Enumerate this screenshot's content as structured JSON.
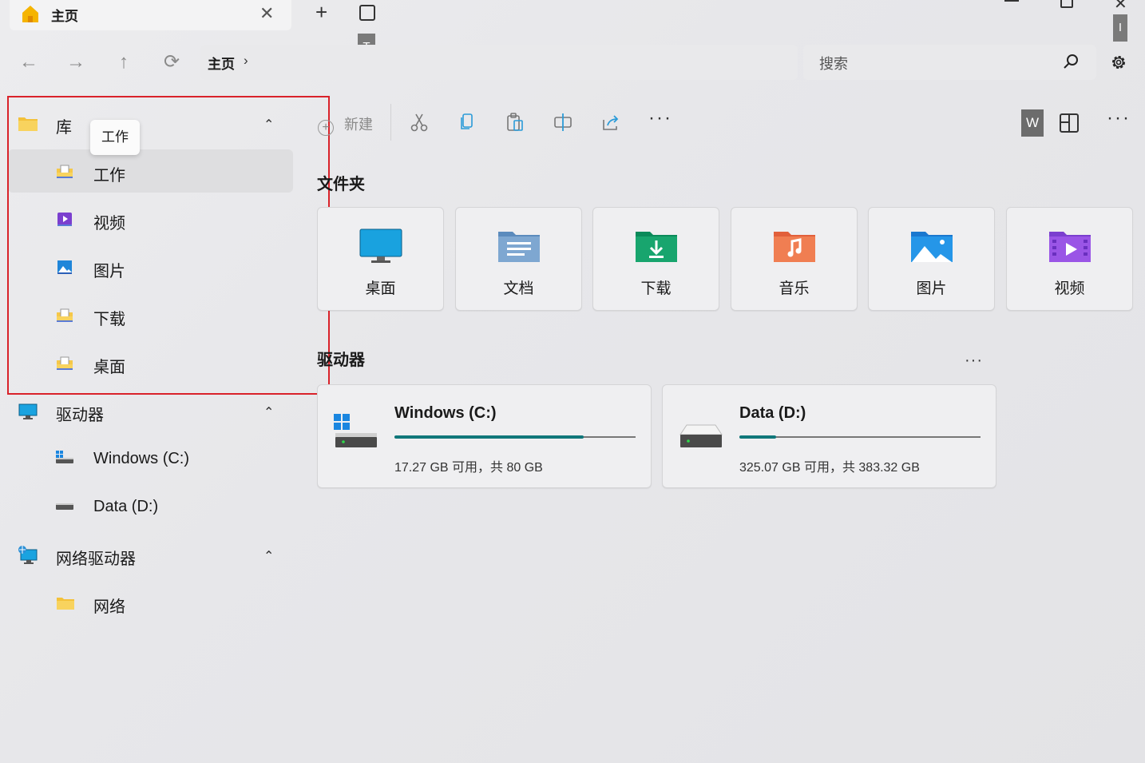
{
  "tab": {
    "title": "主页",
    "close": "✕",
    "new_tab": "+"
  },
  "tooltips": {
    "t": "T",
    "i": "I",
    "work": "工作"
  },
  "nav": {
    "back": "←",
    "forward": "→",
    "up": "↑",
    "refresh": "⟳"
  },
  "breadcrumb": {
    "item": "主页",
    "chevron": "›"
  },
  "search": {
    "placeholder": "搜索"
  },
  "sidebar": {
    "library": {
      "label": "库",
      "chevron": "⌃"
    },
    "library_items": [
      {
        "label": "工作",
        "icon": "doc-folder-icon"
      },
      {
        "label": "视频",
        "icon": "video-icon"
      },
      {
        "label": "图片",
        "icon": "picture-icon"
      },
      {
        "label": "下载",
        "icon": "doc-folder-icon"
      },
      {
        "label": "桌面",
        "icon": "doc-folder-icon"
      }
    ],
    "drives": {
      "label": "驱动器",
      "chevron": "⌃"
    },
    "drive_items": [
      {
        "label": "Windows (C:)"
      },
      {
        "label": "Data (D:)"
      }
    ],
    "network_drives": {
      "label": "网络驱动器",
      "chevron": "⌃"
    },
    "network_items": [
      {
        "label": "网络"
      }
    ]
  },
  "toolbar": {
    "new_label": "新建",
    "more": "···",
    "w": "W",
    "more2": "···"
  },
  "folders": {
    "title": "文件夹",
    "items": [
      {
        "label": "桌面",
        "icon": "desktop-icon"
      },
      {
        "label": "文档",
        "icon": "documents-icon"
      },
      {
        "label": "下载",
        "icon": "downloads-icon"
      },
      {
        "label": "音乐",
        "icon": "music-icon"
      },
      {
        "label": "图片",
        "icon": "pictures-icon"
      },
      {
        "label": "视频",
        "icon": "videos-icon"
      }
    ]
  },
  "drives": {
    "title": "驱动器",
    "more": "···",
    "items": [
      {
        "name": "Windows (C:)",
        "info": "17.27 GB 可用，共 80 GB",
        "used_fraction": 0.784
      },
      {
        "name": "Data (D:)",
        "info": "325.07 GB 可用，共 383.32 GB",
        "used_fraction": 0.152
      }
    ]
  },
  "colors": {
    "accent": "#10777a",
    "highlight_border": "#d9222a"
  }
}
